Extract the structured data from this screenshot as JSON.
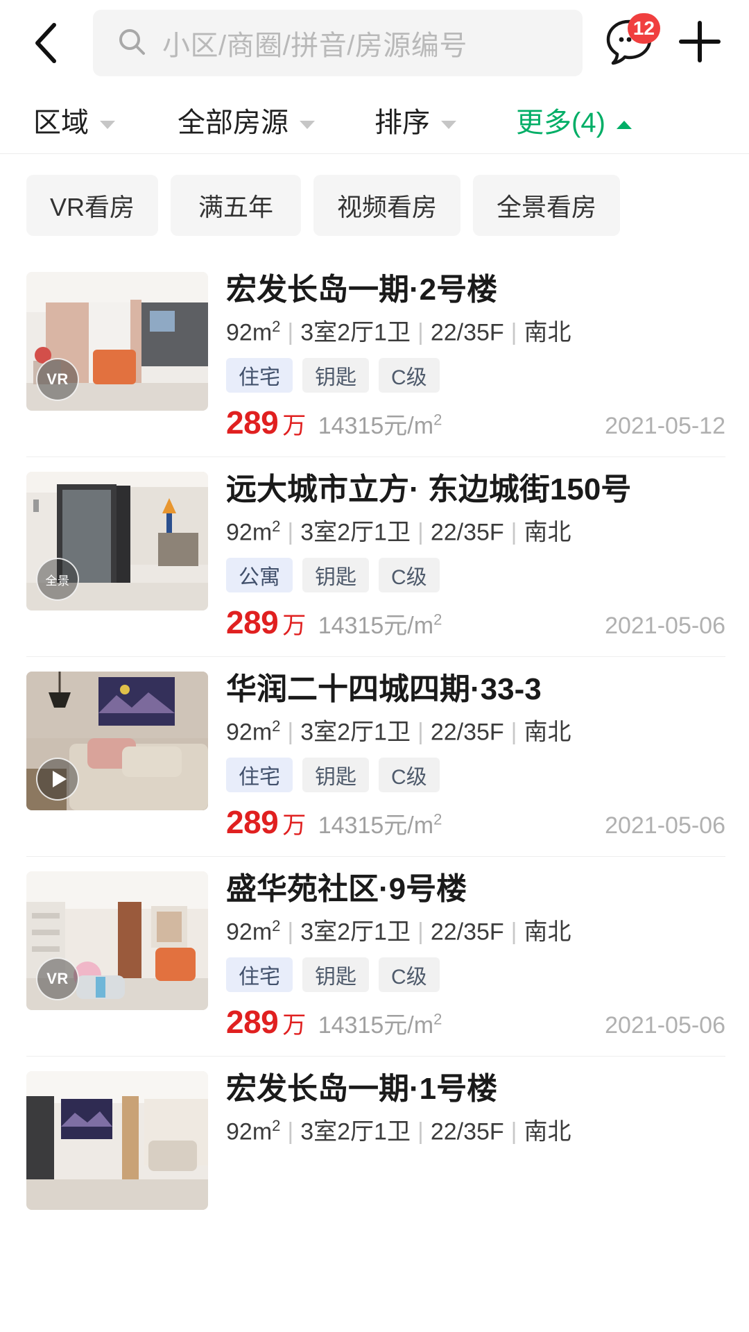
{
  "header": {
    "back_icon": "chevron-left-icon",
    "search": {
      "icon": "search-icon",
      "placeholder": "小区/商圈/拼音/房源编号",
      "value": ""
    },
    "message": {
      "icon": "chat-bubble-icon",
      "badge_count": "12"
    },
    "add": {
      "icon": "plus-icon"
    }
  },
  "filters": [
    {
      "label": "区域",
      "caret": "down",
      "active": false
    },
    {
      "label": "全部房源",
      "caret": "down",
      "active": false
    },
    {
      "label": "排序",
      "caret": "down",
      "active": false
    },
    {
      "label": "更多(4)",
      "caret": "up",
      "active": true
    }
  ],
  "quick_chips": [
    "VR看房",
    "满五年",
    "视频看房",
    "全景看房"
  ],
  "colors": {
    "accent_green": "#00ae66",
    "price_red": "#e02020",
    "badge_red": "#f03f3f",
    "tag_primary_bg": "#e8edfa",
    "tag_bg": "#f1f1f1",
    "chip_bg": "#f5f5f5",
    "search_bg": "#f4f4f4"
  },
  "listings": [
    {
      "title": "宏发长岛一期·2号楼",
      "area": "92m",
      "area_sup": "2",
      "rooms": "3室2厅1卫",
      "floor": "22/35F",
      "orientation": "南北",
      "tags": [
        "住宅",
        "钥匙",
        "C级"
      ],
      "price_total": "289",
      "price_unit_word": "万",
      "price_per": "14315元/m",
      "price_per_sup": "2",
      "date": "2021-05-12",
      "media_badge": "VR",
      "media_type": "vr",
      "photo": "living-room-orange-chair"
    },
    {
      "title": "远大城市立方· 东边城街150号",
      "area": "92m",
      "area_sup": "2",
      "rooms": "3室2厅1卫",
      "floor": "22/35F",
      "orientation": "南北",
      "tags": [
        "公寓",
        "钥匙",
        "C级"
      ],
      "price_total": "289",
      "price_unit_word": "万",
      "price_per": "14315元/m",
      "price_per_sup": "2",
      "date": "2021-05-06",
      "media_badge": "全景",
      "media_type": "pano",
      "photo": "hallway-glass-door"
    },
    {
      "title": "华润二十四城四期·33-3",
      "area": "92m",
      "area_sup": "2",
      "rooms": "3室2厅1卫",
      "floor": "22/35F",
      "orientation": "南北",
      "tags": [
        "住宅",
        "钥匙",
        "C级"
      ],
      "price_total": "289",
      "price_unit_word": "万",
      "price_per": "14315元/m",
      "price_per_sup": "2",
      "date": "2021-05-06",
      "media_badge": "",
      "media_type": "video",
      "photo": "bedroom-pendant-lamp"
    },
    {
      "title": "盛华苑社区·9号楼",
      "area": "92m",
      "area_sup": "2",
      "rooms": "3室2厅1卫",
      "floor": "22/35F",
      "orientation": "南北",
      "tags": [
        "住宅",
        "钥匙",
        "C级"
      ],
      "price_total": "289",
      "price_unit_word": "万",
      "price_per": "14315元/m",
      "price_per_sup": "2",
      "date": "2021-05-06",
      "media_badge": "VR",
      "media_type": "vr",
      "photo": "living-room-toys"
    },
    {
      "title": "宏发长岛一期·1号楼",
      "area": "92m",
      "area_sup": "2",
      "rooms": "3室2厅1卫",
      "floor": "22/35F",
      "orientation": "南北",
      "tags": [],
      "price_total": "",
      "price_unit_word": "",
      "price_per": "",
      "price_per_sup": "",
      "date": "",
      "media_badge": "",
      "media_type": "none",
      "photo": "living-room-artwork"
    }
  ]
}
